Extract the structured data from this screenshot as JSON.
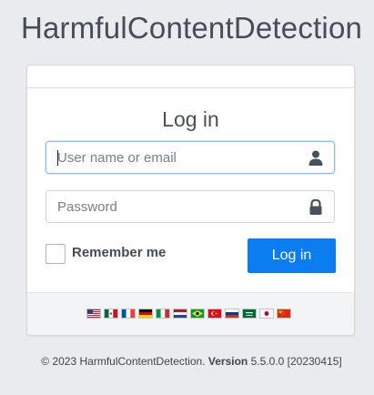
{
  "app": {
    "title": "HarmfulContentDetection"
  },
  "login": {
    "heading": "Log in",
    "username": {
      "placeholder": "User name or email",
      "value": ""
    },
    "password": {
      "placeholder": "Password",
      "value": ""
    },
    "remember_label": "Remember me",
    "remember_checked": false,
    "submit_label": "Log in"
  },
  "languages": [
    {
      "code": "en",
      "icon": "us-flag-icon"
    },
    {
      "code": "es-mx",
      "icon": "mexico-flag-icon"
    },
    {
      "code": "fr",
      "icon": "france-flag-icon"
    },
    {
      "code": "de",
      "icon": "germany-flag-icon"
    },
    {
      "code": "it",
      "icon": "italy-flag-icon"
    },
    {
      "code": "nl",
      "icon": "netherlands-flag-icon"
    },
    {
      "code": "pt-br",
      "icon": "brazil-flag-icon"
    },
    {
      "code": "tr",
      "icon": "turkey-flag-icon"
    },
    {
      "code": "ru",
      "icon": "russia-flag-icon"
    },
    {
      "code": "ar",
      "icon": "saudi-arabia-flag-icon"
    },
    {
      "code": "ja",
      "icon": "japan-flag-icon"
    },
    {
      "code": "zh",
      "icon": "china-flag-icon"
    }
  ],
  "footer": {
    "copyright": "© 2023 HarmfulContentDetection.",
    "version_label": "Version",
    "version_value": "5.5.0.0 [20230415]"
  },
  "colors": {
    "background": "#e9ecef",
    "primary": "#0b7df0",
    "focus_border": "#80bdff"
  }
}
